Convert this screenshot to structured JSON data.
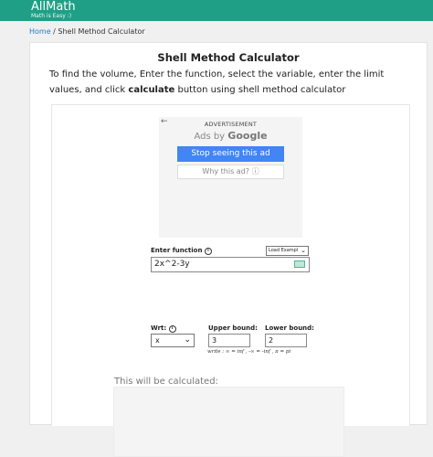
{
  "brand": {
    "name": "AllMath",
    "tagline": "Math is Easy :)"
  },
  "breadcrumb": {
    "home": "Home",
    "separator": " / ",
    "current": "Shell Method Calculator"
  },
  "page": {
    "title": "Shell Method Calculator",
    "intro_before": "To find the volume, Enter the function, select the variable, enter the limit values, and click ",
    "intro_bold": "calculate",
    "intro_after": " button using shell method calculator"
  },
  "ad": {
    "label": "ADVERTISEMENT",
    "ads_by": "Ads by ",
    "google": "Google",
    "stop_button": "Stop seeing this ad",
    "why_button": "Why this ad? ⓘ"
  },
  "form": {
    "function_label": "Enter function",
    "load_example": "Load Exampl",
    "function_value": "2x^2-3y",
    "wrt_label": "Wrt:",
    "wrt_value": "x",
    "upper_label": "Upper bound:",
    "upper_value": "3",
    "lower_label": "Lower bound:",
    "lower_value": "2",
    "hint": "write : ∞ = inf , -∞ = -inf , π = pi",
    "calc_label": "This will be calculated:"
  },
  "colors": {
    "brand": "#1f9f86",
    "link": "#1f7dbd",
    "google_blue": "#4285f4"
  }
}
